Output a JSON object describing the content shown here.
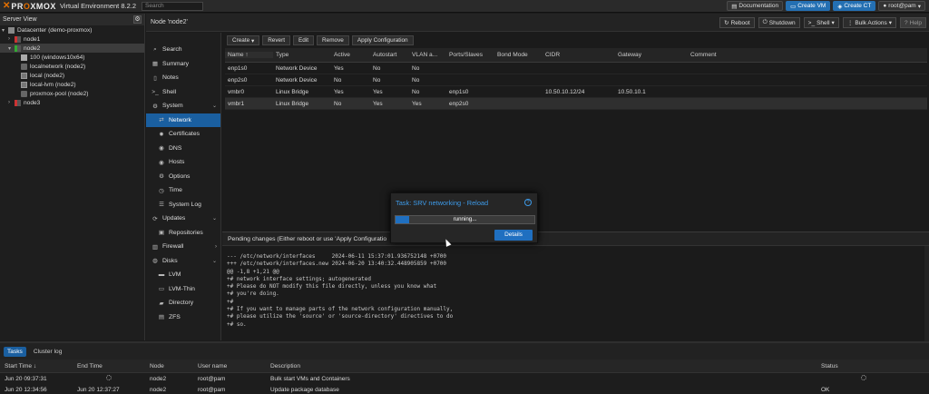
{
  "app": {
    "logo_text_prefix": "PR",
    "logo_text_o": "O",
    "logo_text_suffix": "XMOX",
    "version": "Virtual Environment 8.2.2",
    "search_placeholder": "Search"
  },
  "topbar": {
    "documentation": "Documentation",
    "create_vm": "Create VM",
    "create_ct": "Create CT",
    "user": "root@pam"
  },
  "tree": {
    "title": "Server View",
    "items": [
      {
        "label": "Datacenter (demo-proxmox)",
        "icon": "datacenter-icon"
      },
      {
        "label": "node1",
        "icon": "node-icon"
      },
      {
        "label": "node2",
        "icon": "node-icon"
      },
      {
        "label": "100 (windows10x64)",
        "icon": "vm-icon"
      },
      {
        "label": "localnetwork (node2)",
        "icon": "network-icon"
      },
      {
        "label": "local (node2)",
        "icon": "storage-icon"
      },
      {
        "label": "local-lvm (node2)",
        "icon": "storage-icon"
      },
      {
        "label": "proxmox-pool (node2)",
        "icon": "pool-icon"
      },
      {
        "label": "node3",
        "icon": "node-icon"
      }
    ]
  },
  "nodehead": {
    "title": "Node 'node2'",
    "reboot": "Reboot",
    "shutdown": "Shutdown",
    "shell": "Shell",
    "bulk": "Bulk Actions",
    "help": "Help"
  },
  "nav": {
    "items": [
      {
        "label": "Search",
        "icon": "search-icon"
      },
      {
        "label": "Summary",
        "icon": "summary-icon"
      },
      {
        "label": "Notes",
        "icon": "notes-icon"
      },
      {
        "label": "Shell",
        "icon": "shell-icon"
      },
      {
        "label": "System",
        "icon": "gear-icon"
      },
      {
        "label": "Network",
        "icon": "network-icon"
      },
      {
        "label": "Certificates",
        "icon": "certificate-icon"
      },
      {
        "label": "DNS",
        "icon": "globe-icon"
      },
      {
        "label": "Hosts",
        "icon": "globe-icon"
      },
      {
        "label": "Options",
        "icon": "gear-icon"
      },
      {
        "label": "Time",
        "icon": "clock-icon"
      },
      {
        "label": "System Log",
        "icon": "list-icon"
      },
      {
        "label": "Updates",
        "icon": "refresh-icon"
      },
      {
        "label": "Repositories",
        "icon": "repository-icon"
      },
      {
        "label": "Firewall",
        "icon": "shield-icon"
      },
      {
        "label": "Disks",
        "icon": "disk-icon"
      },
      {
        "label": "LVM",
        "icon": "lvm-icon"
      },
      {
        "label": "LVM-Thin",
        "icon": "lvm-icon"
      },
      {
        "label": "Directory",
        "icon": "folder-icon"
      },
      {
        "label": "ZFS",
        "icon": "zfs-icon"
      }
    ]
  },
  "network": {
    "toolbar": {
      "create": "Create",
      "revert": "Revert",
      "edit": "Edit",
      "remove": "Remove",
      "apply": "Apply Configuration"
    },
    "columns": [
      "Name ↑",
      "Type",
      "Active",
      "Autostart",
      "VLAN a...",
      "Ports/Slaves",
      "Bond Mode",
      "CIDR",
      "Gateway",
      "Comment"
    ],
    "rows": [
      [
        "enp1s0",
        "Network Device",
        "Yes",
        "No",
        "No",
        "",
        "",
        "",
        "",
        ""
      ],
      [
        "enp2s0",
        "Network Device",
        "No",
        "No",
        "No",
        "",
        "",
        "",
        "",
        ""
      ],
      [
        "vmbr0",
        "Linux Bridge",
        "Yes",
        "Yes",
        "No",
        "enp1s0",
        "",
        "10.50.10.12/24",
        "10.50.10.1",
        ""
      ],
      [
        "vmbr1",
        "Linux Bridge",
        "No",
        "Yes",
        "Yes",
        "enp2s0",
        "",
        "",
        "",
        ""
      ]
    ]
  },
  "pending": {
    "title": "Pending changes (Either reboot or use 'Apply Configuratio",
    "diff": "--- /etc/network/interfaces     2024-06-11 15:37:01.936752148 +0700\n+++ /etc/network/interfaces.new 2024-06-20 13:40:32.448905859 +0700\n@@ -1,8 +1,21 @@\n+# network interface settings; autogenerated\n+# Please do NOT modify this file directly, unless you know what\n+# you're doing.\n+#\n+# If you want to manage parts of the network configuration manually,\n+# please utilize the 'source' or 'source-directory' directives to do\n+# so."
  },
  "dialog": {
    "title": "Task: SRV networking - Reload",
    "status": "running...",
    "progress": 0.1,
    "details": "Details"
  },
  "tasks": {
    "tabs": [
      "Tasks",
      "Cluster log"
    ],
    "columns": [
      "Start Time ↓",
      "End Time",
      "Node",
      "User name",
      "Description",
      "Status"
    ],
    "rows": [
      [
        "Jun 20 09:37:31",
        "",
        "node2",
        "root@pam",
        "Bulk start VMs and Containers",
        ""
      ],
      [
        "Jun 20 12:34:56",
        "Jun 20 12:37:27",
        "node2",
        "root@pam",
        "Update package database",
        "OK"
      ]
    ]
  }
}
